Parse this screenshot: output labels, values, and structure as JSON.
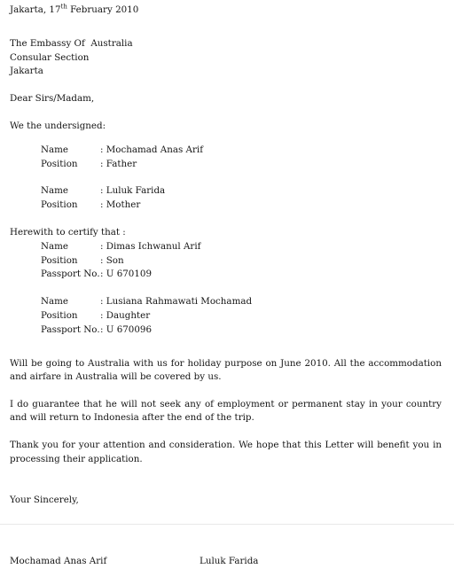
{
  "document": {
    "date_line": {
      "prefix": "Jakarta, 17",
      "ordinal": "th",
      "suffix": " February 2010"
    },
    "recipient": [
      "The Embassy Of  Australia",
      "Consular Section",
      "Jakarta"
    ],
    "salutation": "Dear Sirs/Madam,",
    "undersigned_intro": "We the undersigned:",
    "undersigned": [
      {
        "name_label": "Name",
        "name_value": ": Mochamad Anas Arif",
        "position_label": "Position",
        "position_value": ": Father"
      },
      {
        "name_label": "Name",
        "name_value": ": Luluk Farida",
        "position_label": "Position",
        "position_value": ": Mother"
      }
    ],
    "certify_intro": "Herewith to certify that :",
    "certified": [
      {
        "name_label": "Name",
        "name_value": ": Dimas Ichwanul Arif",
        "position_label": "Position",
        "position_value": ": Son",
        "passport_label": "Passport No.",
        "passport_value": ": U 670109"
      },
      {
        "name_label": "Name",
        "name_value": ": Lusiana Rahmawati Mochamad",
        "position_label": "Position",
        "position_value": ": Daughter",
        "passport_label": "Passport No.",
        "passport_value": ": U 670096"
      }
    ],
    "paragraphs": [
      "Will be going to Australia with us for holiday purpose on June 2010. All the accommodation and airfare in Australia will be covered by us.",
      "I do guarantee that he will not seek any of employment or permanent stay in your country and will return to Indonesia after the end of the trip.",
      "Thank you for your attention and consideration. We hope that this Letter will benefit you in processing their application."
    ],
    "closing": "Your Sincerely,",
    "signatories": {
      "left": "Mochamad Anas Arif",
      "right": "Luluk Farida"
    }
  }
}
